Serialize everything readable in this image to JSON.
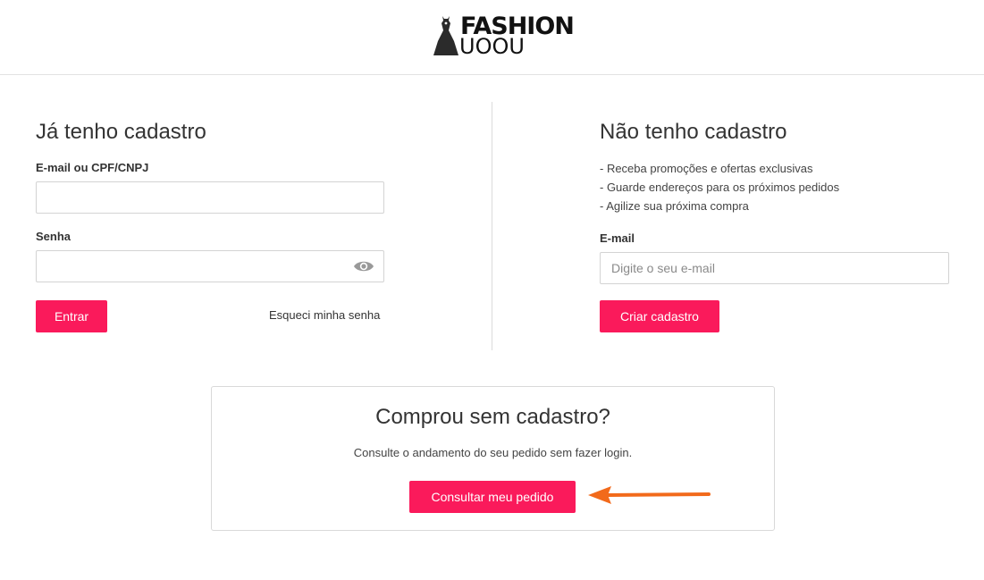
{
  "header": {
    "logo": {
      "line1": "FASHION",
      "line2": "UOOU"
    }
  },
  "login": {
    "title": "Já tenho cadastro",
    "email_label": "E-mail ou CPF/CNPJ",
    "email_value": "",
    "password_label": "Senha",
    "password_value": "",
    "submit_label": "Entrar",
    "forgot_label": "Esqueci minha senha"
  },
  "register": {
    "title": "Não tenho cadastro",
    "benefits": [
      "- Receba promoções e ofertas exclusivas",
      "- Guarde endereços para os próximos pedidos",
      "- Agilize sua próxima compra"
    ],
    "email_label": "E-mail",
    "email_placeholder": "Digite o seu e-mail",
    "submit_label": "Criar cadastro"
  },
  "guest": {
    "title": "Comprou sem cadastro?",
    "text": "Consulte o andamento do seu pedido sem fazer login.",
    "button_label": "Consultar meu pedido"
  },
  "colors": {
    "accent": "#fa1a5b",
    "annotation_arrow": "#f26a1b"
  }
}
